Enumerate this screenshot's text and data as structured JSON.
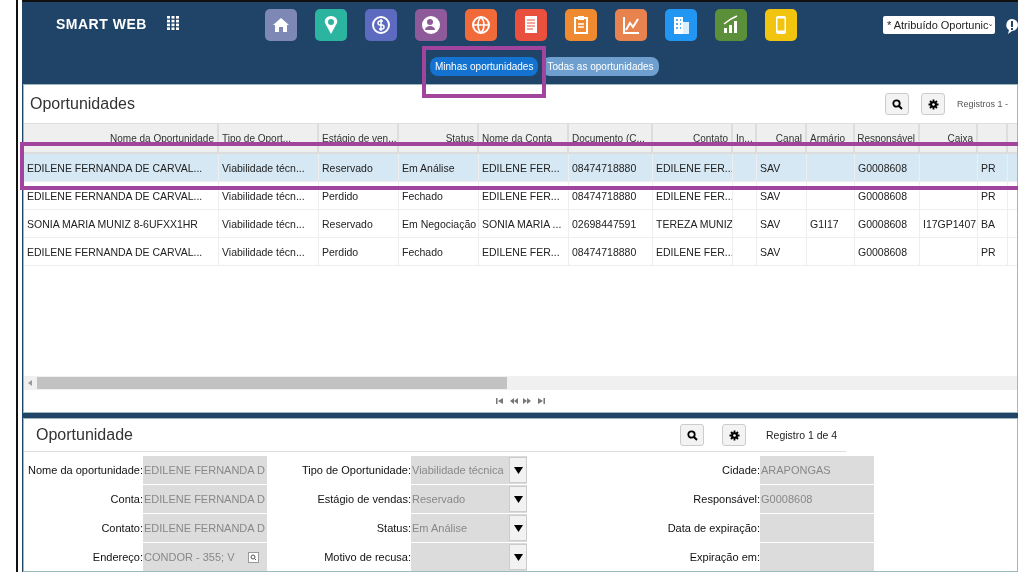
{
  "header": {
    "brand": "SMART WEB",
    "filter_select": "* Atribuído Oportunic"
  },
  "tabs": [
    {
      "label": "Minhas oportunidades",
      "selected": true
    },
    {
      "label": "Todas as oportunidades",
      "selected": false
    }
  ],
  "list_panel": {
    "title": "Oportunidades",
    "records": "Registros 1 -"
  },
  "table": {
    "columns": [
      "Nome da Oportunidade",
      "Tipo de Oport...",
      "Estágio de ven...",
      "Status",
      "Nome da Conta",
      "Documento (C...",
      "Contato",
      "In...",
      "Canal",
      "Armário",
      "Responsável",
      "Caixa"
    ],
    "rows": [
      {
        "selected": true,
        "cells": [
          "EDILENE FERNANDA DE CARVAL...",
          "Viabilidade técn...",
          "Reservado",
          "Em Análise",
          "EDILENE FER...",
          "08474718880",
          "EDILENE FER...",
          "",
          "SAV",
          "",
          "G0008608",
          "",
          "PR"
        ]
      },
      {
        "selected": false,
        "cells": [
          "EDILENE FERNANDA DE CARVAL...",
          "Viabilidade técn...",
          "Perdido",
          "Fechado",
          "EDILENE FER...",
          "08474718880",
          "EDILENE FER...",
          "",
          "SAV",
          "",
          "G0008608",
          "",
          "PR"
        ]
      },
      {
        "selected": false,
        "cells": [
          "SONIA MARIA MUNIZ 8-6UFXX1HR",
          "Viabilidade técn...",
          "Reservado",
          "Em Negociação",
          "SONIA MARIA ...",
          "02698447591",
          "TEREZA MUNIZ",
          "",
          "SAV",
          "G1I17",
          "G0008608",
          "I17GP1407",
          "BA"
        ]
      },
      {
        "selected": false,
        "cells": [
          "EDILENE FERNANDA DE CARVAL...",
          "Viabilidade técn...",
          "Perdido",
          "Fechado",
          "EDILENE FER...",
          "08474718880",
          "EDILENE FER...",
          "",
          "SAV",
          "",
          "G0008608",
          "",
          "PR"
        ]
      }
    ]
  },
  "detail_panel": {
    "title": "Oportunidade",
    "records": "Registro 1 de 4",
    "rows": [
      {
        "label_1": "Nome da oportunidade:",
        "value_1": "EDILENE FERNANDA D",
        "label_2": "Tipo de Oportunidade:",
        "value_2": "Viabilidade técnica",
        "label_3": "Cidade:",
        "value_3": "ARAPONGAS"
      },
      {
        "label_1": "Conta:",
        "value_1": "EDILENE FERNANDA D",
        "label_2": "Estágio de vendas:",
        "value_2": "Reservado",
        "label_3": "Responsável:",
        "value_3": "G0008608"
      },
      {
        "label_1": "Contato:",
        "value_1": "EDILENE FERNANDA D",
        "label_2": "Status:",
        "value_2": "Em Análise",
        "label_3": "Data de expiração:",
        "value_3": ""
      },
      {
        "label_1": "Endereço:",
        "value_1": "CONDOR - 355; V",
        "lookup": true,
        "label_2": "Motivo de recusa:",
        "value_2": "",
        "label_3": "Expiração em:",
        "value_3": ""
      }
    ]
  }
}
